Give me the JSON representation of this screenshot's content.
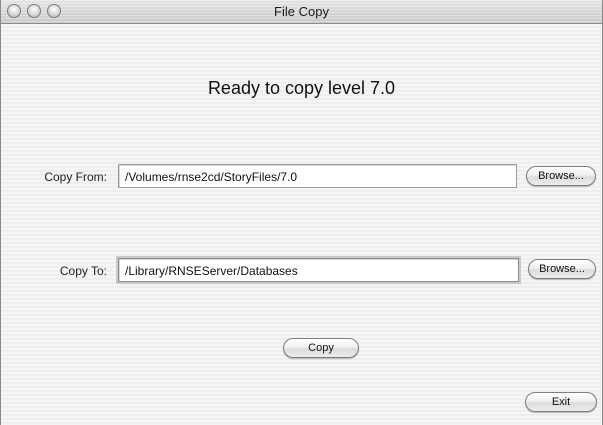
{
  "window": {
    "title": "File Copy"
  },
  "main": {
    "heading": "Ready to copy level 7.0"
  },
  "copy_from": {
    "label": "Copy From:",
    "value": "/Volumes/rnse2cd/StoryFiles/7.0",
    "browse_label": "Browse..."
  },
  "copy_to": {
    "label": "Copy To:",
    "value": "/Library/RNSEServer/Databases",
    "browse_label": "Browse..."
  },
  "actions": {
    "copy_label": "Copy",
    "exit_label": "Exit"
  }
}
